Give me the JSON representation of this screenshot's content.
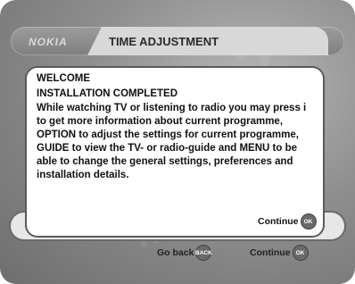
{
  "header": {
    "brand": "NOKIA",
    "title": "TIME ADJUSTMENT"
  },
  "dialog": {
    "heading": "WELCOME",
    "subheading": "INSTALLATION COMPLETED",
    "body": "While watching TV or listening to radio you may press i to get more information about current programme, OPTION to adjust the settings for current programme, GUIDE to view the TV- or radio-guide and MENU to be able to change the general settings, preferences and installation details.",
    "continue_label": "Continue",
    "continue_icon_text": "OK"
  },
  "footer": {
    "go_back_label": "Go back",
    "go_back_icon_text": "BACK",
    "continue_label": "Continue",
    "continue_icon_text": "OK"
  },
  "colors": {
    "background": "#8f8f8f",
    "dialog": "#ffffff",
    "title_tab": "#d8d8d8",
    "button_icon": "#6a6a6a"
  }
}
